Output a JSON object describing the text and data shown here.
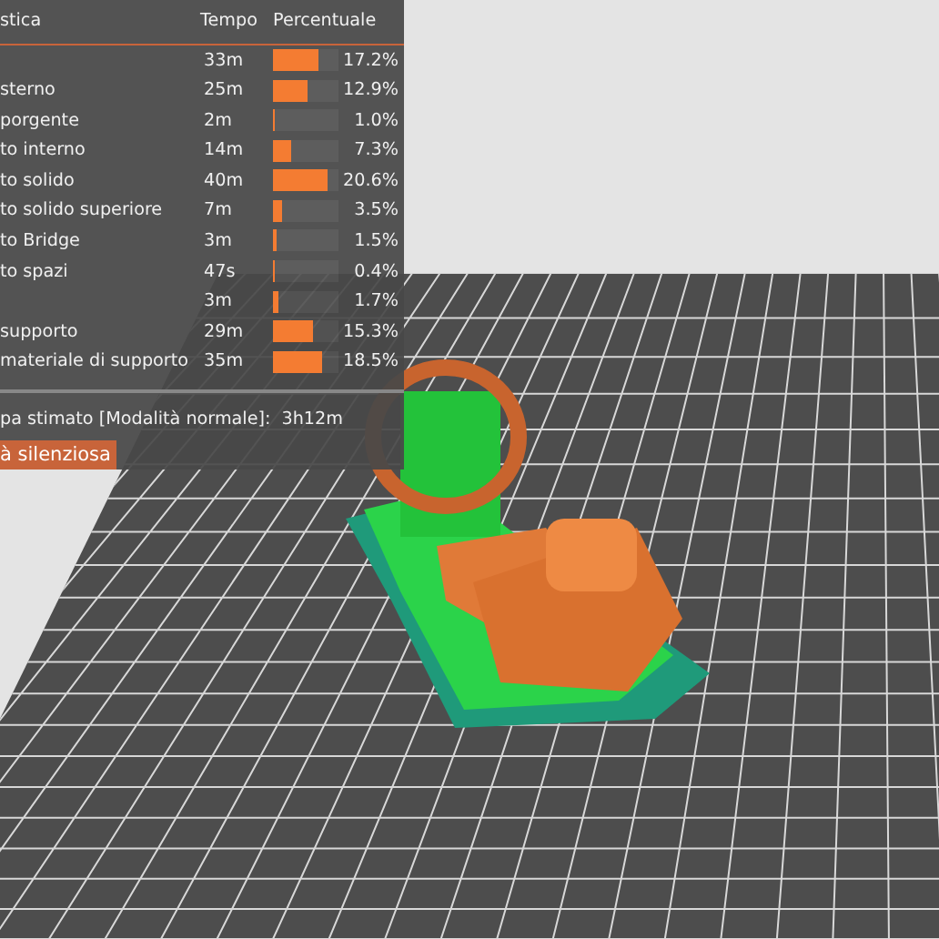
{
  "stats_panel": {
    "columns": [
      "stica",
      "Tempo",
      "Percentuale"
    ],
    "rows": [
      {
        "label": "",
        "time": "33m",
        "level": 0.69,
        "percent": "17.2%"
      },
      {
        "label": "sterno",
        "time": "25m",
        "level": 0.52,
        "percent": "12.9%"
      },
      {
        "label": "porgente",
        "time": "2m",
        "level": 0.04,
        "percent": "1.0%"
      },
      {
        "label": "to interno",
        "time": "14m",
        "level": 0.29,
        "percent": "7.3%"
      },
      {
        "label": "to solido",
        "time": "40m",
        "level": 0.82,
        "percent": "20.6%"
      },
      {
        "label": "to solido superiore",
        "time": "7m",
        "level": 0.14,
        "percent": "3.5%"
      },
      {
        "label": "to Bridge",
        "time": "3m",
        "level": 0.06,
        "percent": "1.5%"
      },
      {
        "label": "to spazi",
        "time": "47s",
        "level": 0.016,
        "percent": "0.4%"
      },
      {
        "label": "",
        "time": "3m",
        "level": 0.07,
        "percent": "1.7%"
      },
      {
        "label": " supporto",
        "time": "29m",
        "level": 0.61,
        "percent": "15.3%"
      },
      {
        "label": "materiale di supporto",
        "time": "35m",
        "level": 0.74,
        "percent": "18.5%"
      }
    ],
    "estimate_label": "pa stimato [Modalità normale]:",
    "estimate_value": "3h12m",
    "mode_button": "à silenziosa"
  }
}
